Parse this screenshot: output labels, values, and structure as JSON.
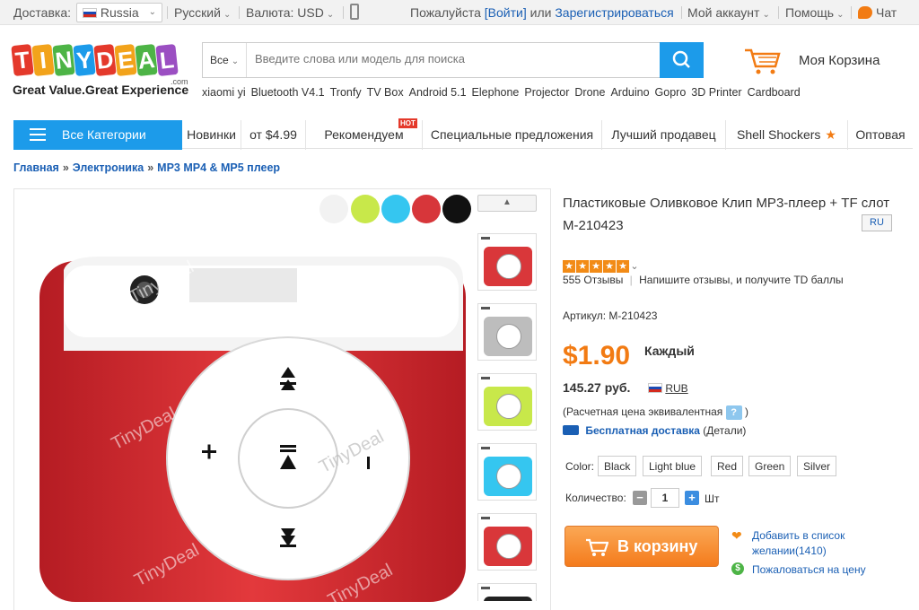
{
  "topbar": {
    "delivery_label": "Доставка:",
    "country": "Russia",
    "language": "Русский",
    "currency_label": "Валюта: USD",
    "please": "Пожалуйста",
    "login": "[Войти]",
    "or": "или",
    "register": "Зарегистрироваться",
    "account": "Мой аккаунт",
    "help": "Помощь",
    "chat": "Чат"
  },
  "logo": {
    "brand": "TINYDEAL",
    "domain": ".com",
    "tagline": "Great Value.Great Experience"
  },
  "search": {
    "category": "Все",
    "placeholder": "Введите слова или модель для поиска"
  },
  "keywords": [
    "xiaomi yi",
    "Bluetooth V4.1",
    "Tronfy",
    "TV Box",
    "Android 5.1",
    "Elephone",
    "Projector",
    "Drone",
    "Arduino",
    "Gopro",
    "3D Printer",
    "Cardboard"
  ],
  "cart": {
    "label": "Моя Корзина"
  },
  "nav": {
    "all_categories": "Все Категории",
    "tabs": [
      "Новинки",
      "от $4.99",
      "Рекомендуем",
      "Специальные предложения",
      "Лучший продавец",
      "Shell Shockers",
      "Оптовая"
    ],
    "hot_badge": "HOT"
  },
  "breadcrumb": [
    "Главная",
    "Электроника",
    "MP3 MP4 & MP5 плеер"
  ],
  "breadcrumb_sep": "»",
  "gallery": {
    "watermark": "TinyDeal",
    "swatch_colors": [
      "#f2f2f2",
      "#c8e84a",
      "#35c6f0",
      "#d7363a",
      "#111111"
    ],
    "thumb_colors": [
      "#d9373a",
      "#bdbdbd",
      "#c8e84a",
      "#35c6f0",
      "#d9373a"
    ]
  },
  "product": {
    "title": "Пластиковые Оливковое Клип MP3-плеер + TF слот M-210423",
    "lang_badge": "RU",
    "rating_stars": 5,
    "reviews": "555 Отзывы",
    "write_review": "Напишите отзывы, и получите TD баллы",
    "sku_label": "Артикул: M-210423",
    "price": "$1.90",
    "per": "Каждый",
    "rub_price": "145.27 руб.",
    "rub_code": "RUB",
    "estimate": "(Расчетная цена эквивалентная",
    "estimate_close": ")",
    "qmark": "?",
    "free_shipping": "Бесплатная доставка",
    "details": "(Детали)",
    "color_label": "Color:",
    "colors": [
      "Black",
      "Light blue",
      "Red",
      "Green",
      "Silver"
    ],
    "qty_label": "Количество:",
    "qty_value": "1",
    "qty_unit": "Шт",
    "add_to_cart": "В корзину",
    "wishlist_line1": "Добавить в список",
    "wishlist_line2": "желании(1410)",
    "complain": "Пожаловаться на цену"
  }
}
